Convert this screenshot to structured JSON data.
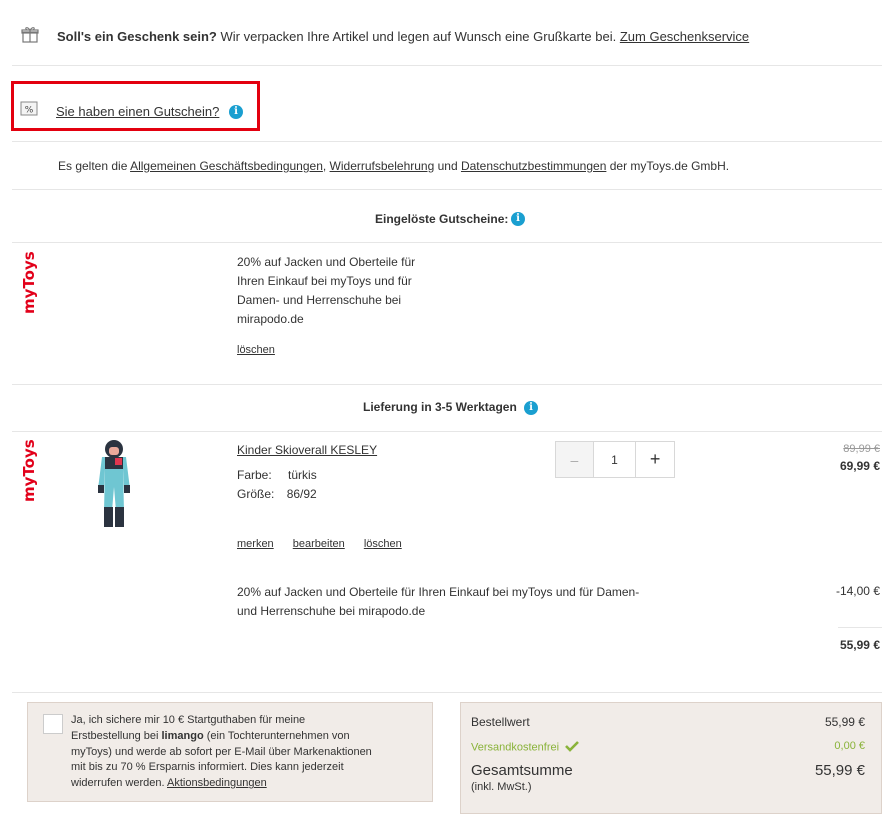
{
  "gift": {
    "bold": "Soll's ein Geschenk sein?",
    "text": " Wir verpacken Ihre Artikel und legen auf Wunsch eine Grußkarte bei. ",
    "link": "Zum Geschenkservice"
  },
  "voucher": {
    "link": "Sie haben einen Gutschein?"
  },
  "terms": {
    "pre": "Es gelten die ",
    "agb": "Allgemeinen Geschäftsbedingungen",
    "sep1": ", ",
    "widerruf": "Widerrufsbelehrung",
    "mid": " und ",
    "datenschutz": "Datenschutzbestimmungen",
    "post": " der myToys.de GmbH."
  },
  "redeemed": {
    "heading": "Eingelöste Gutscheine:",
    "logo": "myToys",
    "lines": [
      "20% auf Jacken und Oberteile für",
      "Ihren Einkauf bei myToys und für",
      "Damen- und Herrenschuhe bei",
      "mirapodo.de"
    ],
    "delete": "löschen"
  },
  "delivery": {
    "heading": "Lieferung in 3-5 Werktagen"
  },
  "item": {
    "logo": "myToys",
    "name": "Kinder Skioverall KESLEY",
    "farbe_label": "Farbe:",
    "farbe_value": "türkis",
    "groesse_label": "Größe:",
    "groesse_value": "86/92",
    "qty_minus": "–",
    "qty_value": "1",
    "qty_plus": "+",
    "old_price": "89,99 €",
    "price": "69,99 €",
    "action_remember": "merken",
    "action_edit": "bearbeiten",
    "action_delete": "löschen",
    "discount_lines": [
      "20% auf Jacken und Oberteile für Ihren Einkauf bei myToys und für Damen-",
      "und Herrenschuhe bei mirapodo.de"
    ],
    "discount_value": "-14,00 €",
    "subtotal": "55,99 €"
  },
  "limango": {
    "line1": "Ja, ich sichere mir 10 € Startguthaben für meine",
    "line2_pre": "Erstbestellung bei ",
    "line2_bold": "limango",
    "line2_post": " (ein Tochterunternehmen von",
    "line3": "myToys) und werde ab sofort per E-Mail über Markenaktionen",
    "line4": "mit bis zu 70 % Ersparnis informiert. Dies kann jederzeit",
    "line5_pre": "widerrufen werden. ",
    "line5_link": "Aktionsbedingungen"
  },
  "summary": {
    "bestellwert_label": "Bestellwert",
    "bestellwert_value": "55,99 €",
    "versand_label": "Versandkostenfrei",
    "versand_value": "0,00 €",
    "total_label": "Gesamtsumme",
    "total_value": "55,99 €",
    "vat_note": "(inkl. MwSt.)"
  },
  "colors": {
    "info": "#1a9fd0",
    "highlight": "#e3000f",
    "green": "#8ab33a",
    "box": "#f1ece8"
  }
}
